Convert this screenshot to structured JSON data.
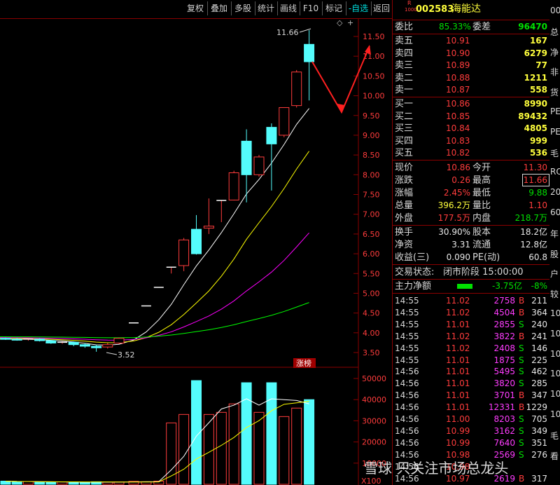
{
  "toolbar": {
    "buttons": [
      "复权",
      "叠加",
      "多股",
      "统计",
      "画线",
      "F10",
      "标记",
      "-自选",
      "返回"
    ]
  },
  "stock": {
    "badge_top": "R",
    "badge_bottom": "1000",
    "code": "002583",
    "name": "海能达"
  },
  "order_ratio": {
    "label1": "委比",
    "value1": "85.33%",
    "label2": "委差",
    "value2": "96470"
  },
  "asks": [
    {
      "label": "卖五",
      "price": "10.91",
      "vol": "167"
    },
    {
      "label": "卖四",
      "price": "10.90",
      "vol": "6279"
    },
    {
      "label": "卖三",
      "price": "10.89",
      "vol": "77"
    },
    {
      "label": "卖二",
      "price": "10.88",
      "vol": "1211"
    },
    {
      "label": "卖一",
      "price": "10.87",
      "vol": "558"
    }
  ],
  "bids": [
    {
      "label": "买一",
      "price": "10.86",
      "vol": "8990"
    },
    {
      "label": "买二",
      "price": "10.85",
      "vol": "89432"
    },
    {
      "label": "买三",
      "price": "10.84",
      "vol": "4805"
    },
    {
      "label": "买四",
      "price": "10.83",
      "vol": "999"
    },
    {
      "label": "买五",
      "price": "10.82",
      "vol": "536"
    }
  ],
  "quote": [
    {
      "l1": "现价",
      "v1": "10.86",
      "l2": "今开",
      "v2": "11.30"
    },
    {
      "l1": "涨跌",
      "v1": "0.26",
      "l2": "最高",
      "v2": "11.66"
    },
    {
      "l1": "涨幅",
      "v1": "2.45%",
      "l2": "最低",
      "v2": "9.88"
    },
    {
      "l1": "总量",
      "v1": "396.2万",
      "l2": "量比",
      "v2": "1.10"
    },
    {
      "l1": "外盘",
      "v1": "177.5万",
      "l2": "内盘",
      "v2": "218.7万"
    }
  ],
  "stats": [
    {
      "l1": "换手",
      "v1": "30.90%",
      "l2": "股本",
      "v2": "18.2亿"
    },
    {
      "l1": "净资",
      "v1": "3.31",
      "l2": "流通",
      "v2": "12.8亿"
    },
    {
      "l1": "收益(三)",
      "v1": "0.090",
      "l2": "PE(动)",
      "v2": "60.8"
    }
  ],
  "status": {
    "label": "交易状态:",
    "value": "闭市阶段 15:00:00"
  },
  "capital": {
    "label": "主力净额",
    "value": "-3.75亿",
    "pct": "-8%"
  },
  "ticks": [
    {
      "t": "14:55",
      "p": "11.02",
      "v": "2758",
      "s": "B",
      "n": "211"
    },
    {
      "t": "14:55",
      "p": "11.02",
      "v": "4504",
      "s": "B",
      "n": "364"
    },
    {
      "t": "14:55",
      "p": "11.01",
      "v": "2855",
      "s": "S",
      "n": "240"
    },
    {
      "t": "14:55",
      "p": "11.02",
      "v": "3822",
      "s": "B",
      "n": "241"
    },
    {
      "t": "14:55",
      "p": "11.02",
      "v": "2408",
      "s": "S",
      "n": "146"
    },
    {
      "t": "14:55",
      "p": "11.01",
      "v": "1875",
      "s": "S",
      "n": "225"
    },
    {
      "t": "14:56",
      "p": "11.01",
      "v": "5495",
      "s": "S",
      "n": "462"
    },
    {
      "t": "14:56",
      "p": "11.01",
      "v": "3820",
      "s": "S",
      "n": "285"
    },
    {
      "t": "14:56",
      "p": "11.01",
      "v": "3701",
      "s": "B",
      "n": "347"
    },
    {
      "t": "14:56",
      "p": "11.01",
      "v": "12331",
      "s": "B",
      "n": "1229"
    },
    {
      "t": "14:56",
      "p": "11.00",
      "v": "8203",
      "s": "S",
      "n": "705"
    },
    {
      "t": "14:56",
      "p": "10.99",
      "v": "3162",
      "s": "S",
      "n": "349"
    },
    {
      "t": "14:56",
      "p": "10.99",
      "v": "7640",
      "s": "S",
      "n": "351"
    },
    {
      "t": "14:56",
      "p": "10.98",
      "v": "2569",
      "s": "S",
      "n": "276"
    },
    {
      "t": "14:56",
      "p": "10.98",
      "v": "",
      "s": "",
      "n": ""
    },
    {
      "t": "14:56",
      "p": "10.97",
      "v": "2619",
      "s": "B",
      "n": "317"
    }
  ],
  "right_edge": [
    "00",
    "总",
    "净",
    "非",
    "货",
    "PE",
    "PE",
    "毛",
    "RO",
    "20",
    "60",
    "年",
    "股",
    "户",
    "较",
    "10",
    "10",
    "10",
    "10",
    "10",
    "10",
    "毛",
    "看"
  ],
  "chart_data": [
    {
      "type": "candlestick",
      "price_axis": {
        "ticks": [
          "11.50",
          "11.00",
          "10.50",
          "10.00",
          "9.50",
          "9.00",
          "8.50",
          "8.00",
          "7.50",
          "7.00",
          "6.50",
          "6.00",
          "5.50",
          "5.00",
          "4.50",
          "4.00",
          "3.50"
        ],
        "ylim": [
          3.3,
          11.8
        ]
      },
      "annotations": {
        "high": "11.66",
        "low": "3.52",
        "tag": "涨榜"
      },
      "candles": [
        {
          "o": 3.86,
          "c": 3.84,
          "h": 3.88,
          "l": 3.82,
          "up": false
        },
        {
          "o": 3.84,
          "c": 3.82,
          "h": 3.87,
          "l": 3.8,
          "up": false
        },
        {
          "o": 3.83,
          "c": 3.84,
          "h": 3.86,
          "l": 3.8,
          "up": true
        },
        {
          "o": 3.84,
          "c": 3.8,
          "h": 3.86,
          "l": 3.78,
          "up": false
        },
        {
          "o": 3.8,
          "c": 3.74,
          "h": 3.82,
          "l": 3.72,
          "up": false
        },
        {
          "o": 3.75,
          "c": 3.76,
          "h": 3.78,
          "l": 3.72,
          "up": true
        },
        {
          "o": 3.76,
          "c": 3.7,
          "h": 3.78,
          "l": 3.66,
          "up": false
        },
        {
          "o": 3.7,
          "c": 3.66,
          "h": 3.74,
          "l": 3.62,
          "up": false
        },
        {
          "o": 3.66,
          "c": 3.62,
          "h": 3.7,
          "l": 3.52,
          "up": false
        },
        {
          "o": 3.64,
          "c": 3.7,
          "h": 3.74,
          "l": 3.6,
          "up": true
        },
        {
          "o": 3.74,
          "c": 3.86,
          "h": 3.88,
          "l": 3.72,
          "up": true
        },
        {
          "o": 4.25,
          "c": 4.25,
          "h": 4.25,
          "l": 4.25,
          "up": true
        },
        {
          "o": 4.68,
          "c": 4.68,
          "h": 4.68,
          "l": 4.68,
          "up": true
        },
        {
          "o": 5.15,
          "c": 5.15,
          "h": 5.15,
          "l": 5.15,
          "up": true
        },
        {
          "o": 5.66,
          "c": 5.66,
          "h": 5.66,
          "l": 5.5,
          "up": true
        },
        {
          "o": 5.7,
          "c": 6.35,
          "h": 6.4,
          "l": 5.56,
          "up": true
        },
        {
          "o": 6.0,
          "c": 6.62,
          "h": 6.98,
          "l": 5.98,
          "up": false
        },
        {
          "o": 6.65,
          "c": 6.7,
          "h": 7.4,
          "l": 6.5,
          "up": true
        },
        {
          "o": 7.35,
          "c": 7.35,
          "h": 7.35,
          "l": 6.8,
          "up": true
        },
        {
          "o": 7.36,
          "c": 8.05,
          "h": 8.1,
          "l": 7.35,
          "up": true
        },
        {
          "o": 8.0,
          "c": 8.85,
          "h": 9.15,
          "l": 7.3,
          "up": false
        },
        {
          "o": 8.0,
          "c": 8.45,
          "h": 8.5,
          "l": 7.95,
          "up": true
        },
        {
          "o": 9.2,
          "c": 8.78,
          "h": 9.3,
          "l": 7.6,
          "up": false
        },
        {
          "o": 9.0,
          "c": 9.7,
          "h": 9.7,
          "l": 8.95,
          "up": true
        },
        {
          "o": 9.75,
          "c": 10.6,
          "h": 10.65,
          "l": 9.7,
          "up": true
        },
        {
          "o": 11.3,
          "c": 10.86,
          "h": 11.66,
          "l": 9.88,
          "up": false
        }
      ],
      "ma_colors": {
        "ma5": "#ffffff",
        "ma10": "#ffff00",
        "ma20": "#ff00ff",
        "ma60": "#00ff00"
      }
    },
    {
      "type": "bar",
      "volume_axis": {
        "ticks": [
          "50000",
          "40000",
          "30000",
          "20000",
          "10000"
        ],
        "unit": "X100",
        "ylim": [
          0,
          55000
        ]
      },
      "values": [
        1500,
        1200,
        1300,
        1000,
        900,
        1100,
        1000,
        900,
        1200,
        1000,
        1100,
        1400,
        1200,
        1500,
        29000,
        33000,
        49000,
        33000,
        34000,
        38000,
        48000,
        34000,
        48000,
        32000,
        36000,
        40000
      ]
    }
  ]
}
